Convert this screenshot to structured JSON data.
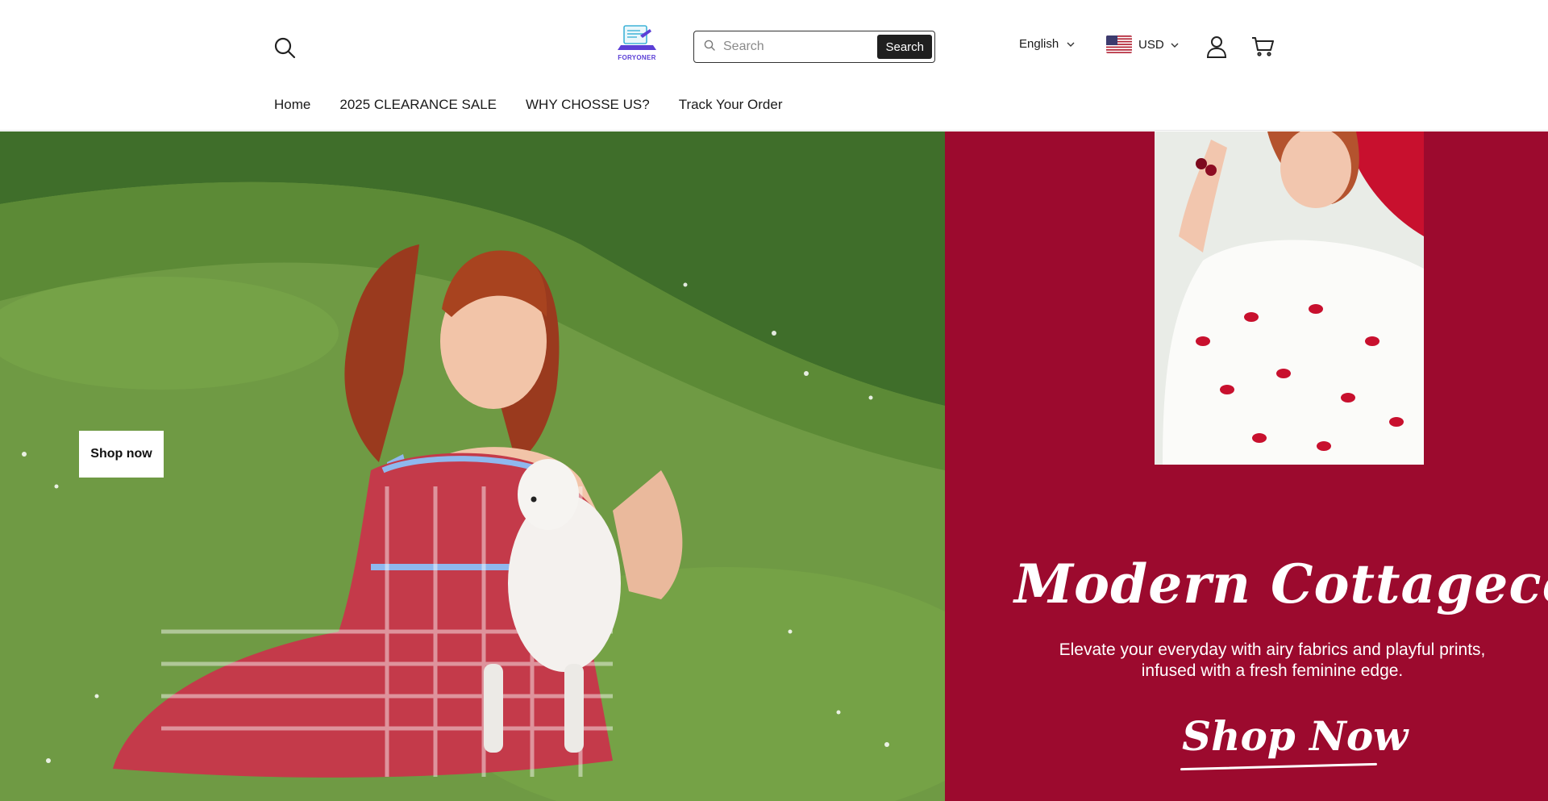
{
  "header": {
    "logo_text": "FORYONER",
    "search": {
      "placeholder": "Search",
      "button_label": "Search"
    },
    "language": {
      "selected": "English"
    },
    "currency": {
      "selected": "USD"
    },
    "icons": {
      "search": "search-icon",
      "account": "user-icon",
      "cart": "cart-icon",
      "chevron": "chevron-down-icon"
    }
  },
  "nav": {
    "items": [
      {
        "label": "Home"
      },
      {
        "label": "2025 CLEARANCE SALE"
      },
      {
        "label": "WHY CHOSSE US?"
      },
      {
        "label": "Track Your Order"
      }
    ]
  },
  "hero": {
    "left": {
      "cta_label": "Shop now"
    },
    "right": {
      "title": "Modern Cottagecore",
      "subtitle_line1": "Elevate your everyday with airy fabrics and playful prints,",
      "subtitle_line2": "infused with a fresh feminine edge.",
      "cta_label": "Shop Now"
    }
  },
  "colors": {
    "promo_background": "#9c0a2e",
    "button_dark": "#1f1f1f",
    "logo_accent": "#5b3fd6"
  }
}
